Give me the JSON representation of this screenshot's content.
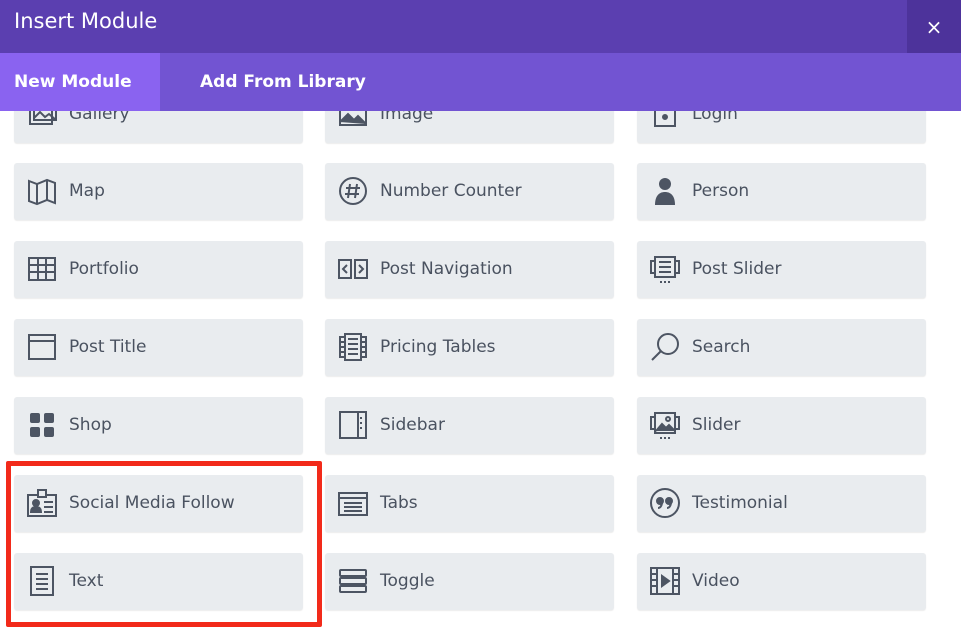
{
  "dialog": {
    "title": "Insert Module",
    "close_glyph": "×",
    "header_color": "#5b3fb0",
    "tabs_color": "#7254d2",
    "active_tab_color": "#8a63f0"
  },
  "tabs": [
    {
      "label": "New Module",
      "active": true
    },
    {
      "label": "Add From Library",
      "active": false
    }
  ],
  "modules": [
    {
      "label": "Gallery",
      "icon": "gallery-icon"
    },
    {
      "label": "Image",
      "icon": "image-icon"
    },
    {
      "label": "Login",
      "icon": "login-icon"
    },
    {
      "label": "Map",
      "icon": "map-icon"
    },
    {
      "label": "Number Counter",
      "icon": "number-counter-icon"
    },
    {
      "label": "Person",
      "icon": "person-icon"
    },
    {
      "label": "Portfolio",
      "icon": "portfolio-icon"
    },
    {
      "label": "Post Navigation",
      "icon": "post-navigation-icon"
    },
    {
      "label": "Post Slider",
      "icon": "post-slider-icon"
    },
    {
      "label": "Post Title",
      "icon": "post-title-icon"
    },
    {
      "label": "Pricing Tables",
      "icon": "pricing-tables-icon"
    },
    {
      "label": "Search",
      "icon": "search-icon"
    },
    {
      "label": "Shop",
      "icon": "shop-icon"
    },
    {
      "label": "Sidebar",
      "icon": "sidebar-icon"
    },
    {
      "label": "Slider",
      "icon": "slider-icon"
    },
    {
      "label": "Social Media Follow",
      "icon": "social-media-follow-icon"
    },
    {
      "label": "Tabs",
      "icon": "tabs-icon"
    },
    {
      "label": "Testimonial",
      "icon": "testimonial-icon"
    },
    {
      "label": "Text",
      "icon": "text-icon"
    },
    {
      "label": "Toggle",
      "icon": "toggle-icon"
    },
    {
      "label": "Video",
      "icon": "video-icon"
    }
  ],
  "highlight": {
    "color": "#f22a1a"
  }
}
